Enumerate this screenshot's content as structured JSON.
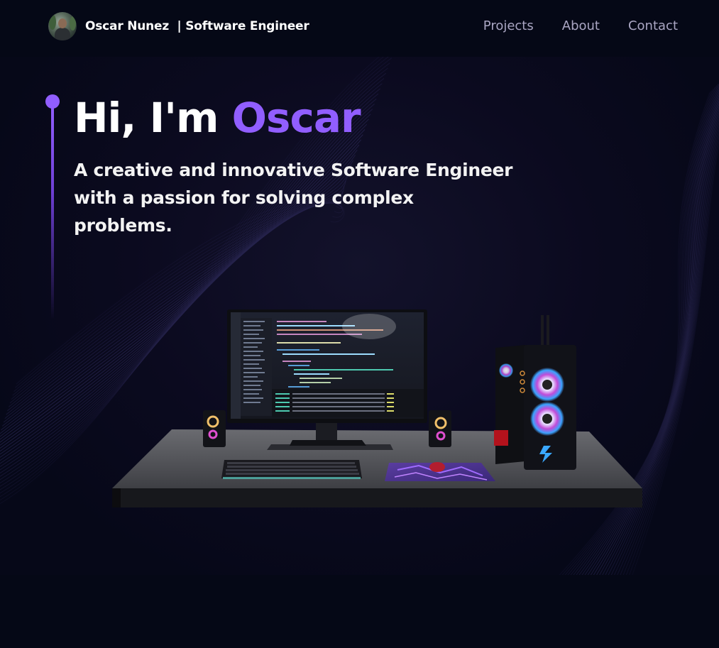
{
  "nav": {
    "brand_name": "Oscar Nunez",
    "brand_subtitle": "| Software Engineer",
    "links": [
      {
        "label": "Projects"
      },
      {
        "label": "About"
      },
      {
        "label": "Contact"
      }
    ]
  },
  "hero": {
    "greeting": "Hi, I'm",
    "name": "Oscar",
    "subtitle_line1": "A creative and innovative Software Engineer",
    "subtitle_line2": "with a passion for solving complex problems."
  },
  "colors": {
    "background": "#050816",
    "accent": "#915eff",
    "nav_text": "#aaa6c3"
  },
  "icons": [
    "avatar-photo",
    "accent-dot",
    "desk-computer-scene"
  ]
}
